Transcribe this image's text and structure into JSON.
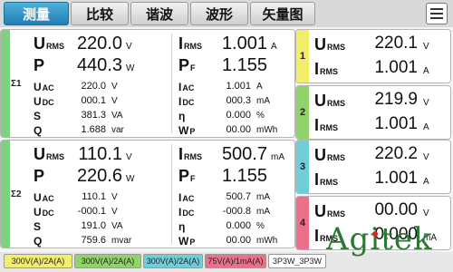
{
  "tabs": [
    {
      "label": "测量",
      "active": true
    },
    {
      "label": "比较",
      "active": false
    },
    {
      "label": "谐波",
      "active": false
    },
    {
      "label": "波形",
      "active": false
    },
    {
      "label": "矢量图",
      "active": false
    }
  ],
  "menu_icon": "hamburger-menu-icon",
  "sigma_panels": [
    {
      "label": "Σ1",
      "left": [
        {
          "sym": "U",
          "sub": "RMS",
          "value": "220.0",
          "unit": "V"
        },
        {
          "sym": "P",
          "sub": "",
          "value": "440.3",
          "unit": "W"
        },
        {
          "sym": "U",
          "sub": "AC",
          "value": "220.0",
          "unit": "V"
        },
        {
          "sym": "U",
          "sub": "DC",
          "value": "000.1",
          "unit": "V"
        },
        {
          "sym": "S",
          "sub": "",
          "value": "381.3",
          "unit": "VA"
        },
        {
          "sym": "Q",
          "sub": "",
          "value": "1.688",
          "unit": "var"
        }
      ],
      "right": [
        {
          "sym": "I",
          "sub": "RMS",
          "value": "1.001",
          "unit": "A"
        },
        {
          "sym": "P",
          "sub": "F",
          "value": "1.155",
          "unit": ""
        },
        {
          "sym": "I",
          "sub": "AC",
          "value": "1.001",
          "unit": "A"
        },
        {
          "sym": "I",
          "sub": "DC",
          "value": "000.3",
          "unit": "mA"
        },
        {
          "sym": "η",
          "sub": "",
          "value": "0.000",
          "unit": "%"
        },
        {
          "sym": "W",
          "sub": "P",
          "value": "00.00",
          "unit": "mWh"
        }
      ]
    },
    {
      "label": "Σ2",
      "left": [
        {
          "sym": "U",
          "sub": "RMS",
          "value": "110.1",
          "unit": "V"
        },
        {
          "sym": "P",
          "sub": "",
          "value": "220.6",
          "unit": "W"
        },
        {
          "sym": "U",
          "sub": "AC",
          "value": "110.1",
          "unit": "V"
        },
        {
          "sym": "U",
          "sub": "DC",
          "value": "-000.1",
          "unit": "V"
        },
        {
          "sym": "S",
          "sub": "",
          "value": "191.0",
          "unit": "VA"
        },
        {
          "sym": "Q",
          "sub": "",
          "value": "759.6",
          "unit": "mvar"
        }
      ],
      "right": [
        {
          "sym": "I",
          "sub": "RMS",
          "value": "500.7",
          "unit": "mA"
        },
        {
          "sym": "P",
          "sub": "F",
          "value": "1.155",
          "unit": ""
        },
        {
          "sym": "I",
          "sub": "AC",
          "value": "500.7",
          "unit": "mA"
        },
        {
          "sym": "I",
          "sub": "DC",
          "value": "-000.8",
          "unit": "mA"
        },
        {
          "sym": "η",
          "sub": "",
          "value": "0.000",
          "unit": "%"
        },
        {
          "sym": "W",
          "sub": "P",
          "value": "00.00",
          "unit": "mWh"
        }
      ]
    }
  ],
  "channels": [
    {
      "num": "1",
      "color": "#f2ee6a",
      "u": {
        "sym": "U",
        "sub": "RMS",
        "value": "220.1",
        "unit": "V"
      },
      "i": {
        "sym": "I",
        "sub": "RMS",
        "value": "1.001",
        "unit": "A"
      }
    },
    {
      "num": "2",
      "color": "#8fd36a",
      "u": {
        "sym": "U",
        "sub": "RMS",
        "value": "219.9",
        "unit": "V"
      },
      "i": {
        "sym": "I",
        "sub": "RMS",
        "value": "1.001",
        "unit": "A"
      }
    },
    {
      "num": "3",
      "color": "#6fcfd8",
      "u": {
        "sym": "U",
        "sub": "RMS",
        "value": "220.2",
        "unit": "V"
      },
      "i": {
        "sym": "I",
        "sub": "RMS",
        "value": "1.001",
        "unit": "A"
      }
    },
    {
      "num": "4",
      "color": "#ee6f8a",
      "u": {
        "sym": "U",
        "sub": "RMS",
        "value": "00.00",
        "unit": "V"
      },
      "i": {
        "sym": "I",
        "sub": "RMS",
        "value": "0.000",
        "unit": "mA"
      }
    }
  ],
  "status_items": [
    {
      "text": "300V(A)/2A(A)",
      "color": "#f2ee6a"
    },
    {
      "text": "300V(A)/2A(A)",
      "color": "#8fd36a"
    },
    {
      "text": "300V(A)/2A(A)",
      "color": "#6fcfd8"
    },
    {
      "text": "75V(A)/1mA(A)",
      "color": "#ee6f8a"
    },
    {
      "text": "3P3W_3P3W",
      "color": ""
    }
  ],
  "watermark": "Agitek"
}
